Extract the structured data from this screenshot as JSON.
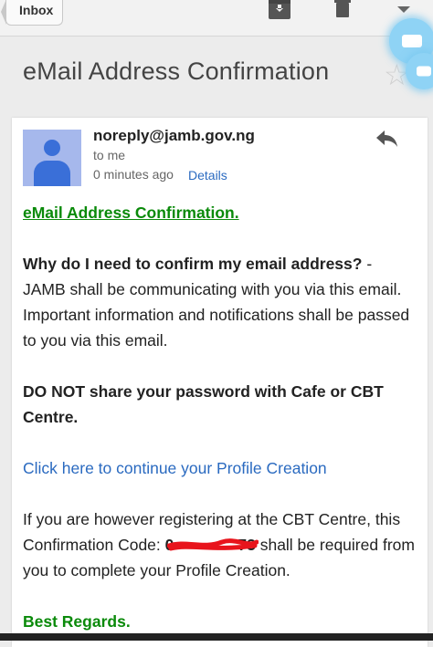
{
  "toolbar": {
    "back_label": "Inbox",
    "archive_icon": "archive-icon",
    "delete_icon": "trash-icon",
    "more_icon": "dropdown-arrow-icon"
  },
  "email": {
    "subject": "eMail Address Confirmation",
    "sender": "noreply@jamb.gov.ng",
    "recipient": "to me",
    "time": "0 minutes ago",
    "details_label": "Details",
    "body": {
      "heading_link": "eMail Address Confirmation.",
      "why_bold": "Why do I need to confirm my email address?",
      "why_text": " - JAMB shall be communicating with you via this email. Important information and notifications shall be passed to you via this email.",
      "warning": "DO NOT share your password with Cafe or CBT Centre.",
      "continue_link": "Click here to continue your Profile Creation",
      "cbt_text_1": "If you are however registering at the CBT Centre, this Confirmation Code: ",
      "code_visible_start": "0",
      "code_visible_end": "73",
      "cbt_text_2": " shall be required from you to complete your Profile Creation.",
      "regards": "Best Regards."
    }
  },
  "colors": {
    "link_green": "#0a8a0a",
    "link_blue": "#2a6ac0",
    "avatar": "#3a6fd8",
    "redaction": "#e8141c"
  }
}
